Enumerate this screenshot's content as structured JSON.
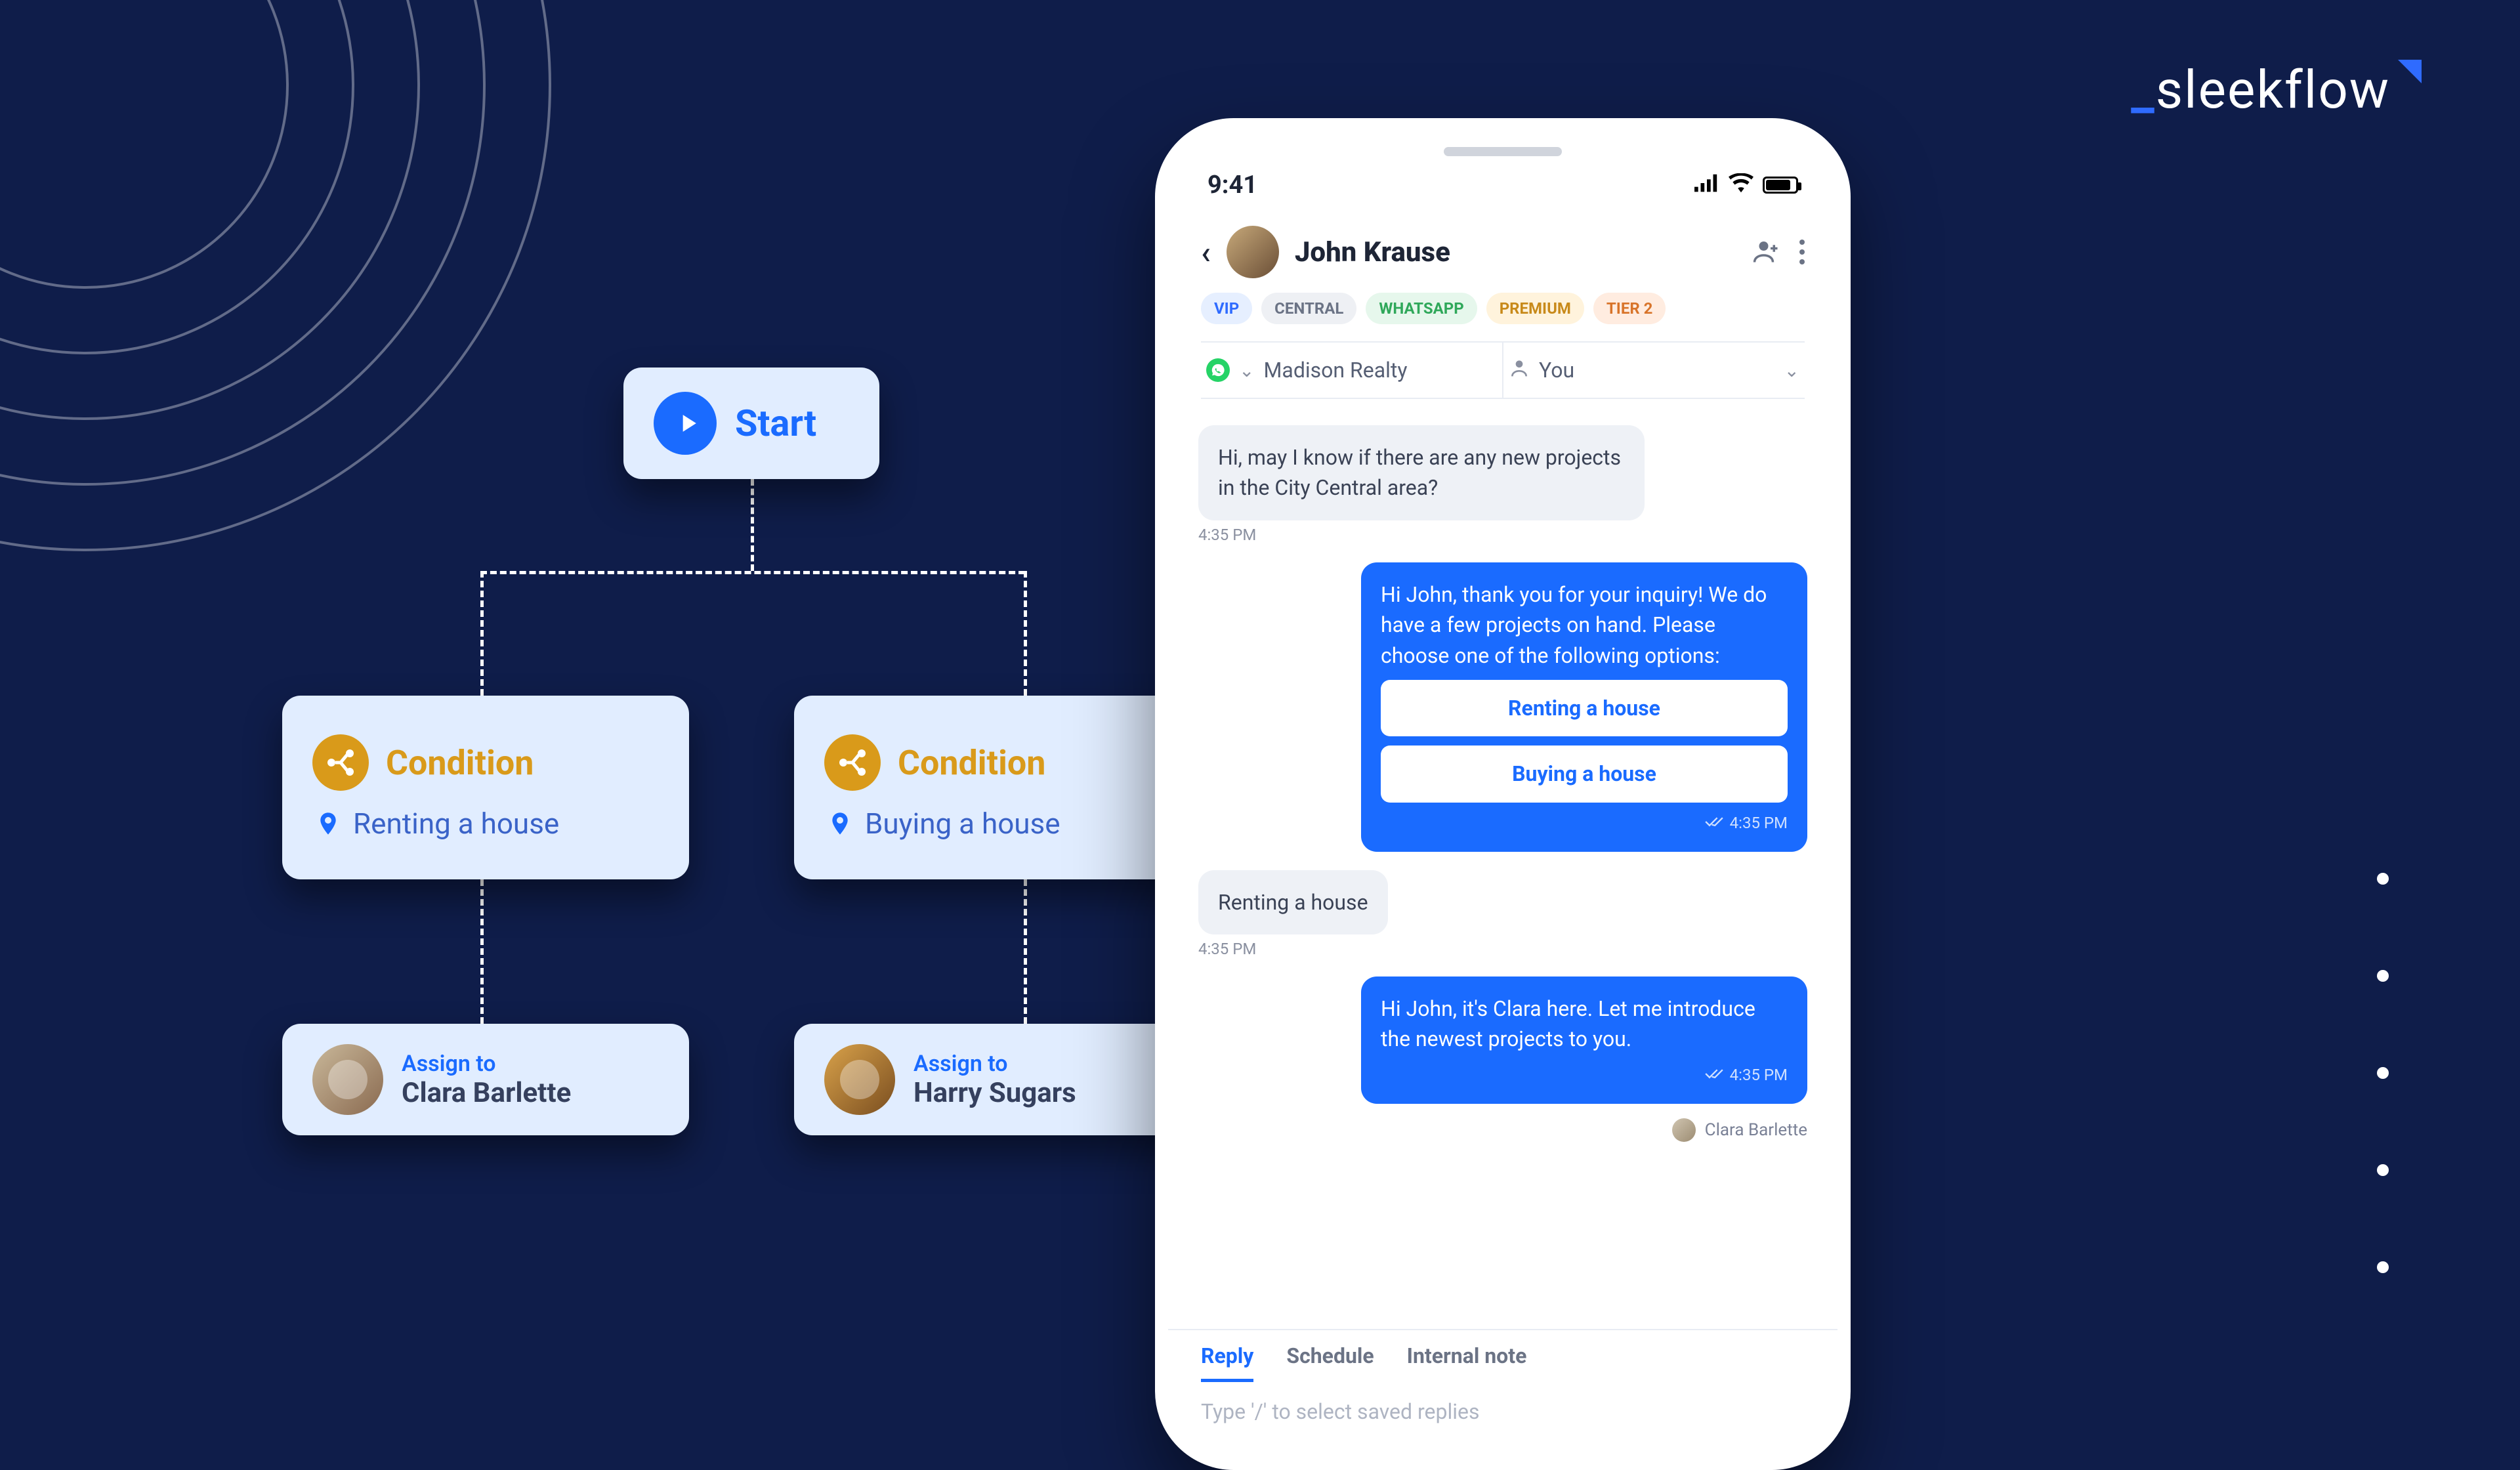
{
  "brand": {
    "name": "sleekflow"
  },
  "flow": {
    "start": "Start",
    "conditions": [
      {
        "title": "Condition",
        "value": "Renting a house"
      },
      {
        "title": "Condition",
        "value": "Buying a house"
      }
    ],
    "assign_label": "Assign to",
    "assignees": [
      {
        "name": "Clara Barlette"
      },
      {
        "name": "Harry Sugars"
      }
    ]
  },
  "phone": {
    "status_time": "9:41",
    "contact_name": "John Krause",
    "tags": {
      "vip": "VIP",
      "central": "CENTRAL",
      "whatsapp": "WHATSAPP",
      "premium": "PREMIUM",
      "tier": "TIER 2"
    },
    "channel": "Madison Realty",
    "assignee": "You",
    "messages": {
      "m1": {
        "text": "Hi, may I know if there are any new projects in the City Central area?",
        "time": "4:35 PM"
      },
      "m2": {
        "text": "Hi John, thank you for your inquiry! We do have a few projects on hand. Please choose one of the following options:",
        "option1": "Renting a house",
        "option2": "Buying a house",
        "time": "4:35 PM"
      },
      "m3": {
        "text": "Renting a house",
        "time": "4:35 PM"
      },
      "m4": {
        "text": "Hi John, it's Clara here. Let me introduce the newest projects to you.",
        "time": "4:35 PM"
      }
    },
    "sender_caption": "Clara Barlette",
    "composer": {
      "tabs": {
        "reply": "Reply",
        "schedule": "Schedule",
        "note": "Internal note"
      },
      "placeholder": "Type '/' to select saved replies"
    }
  }
}
